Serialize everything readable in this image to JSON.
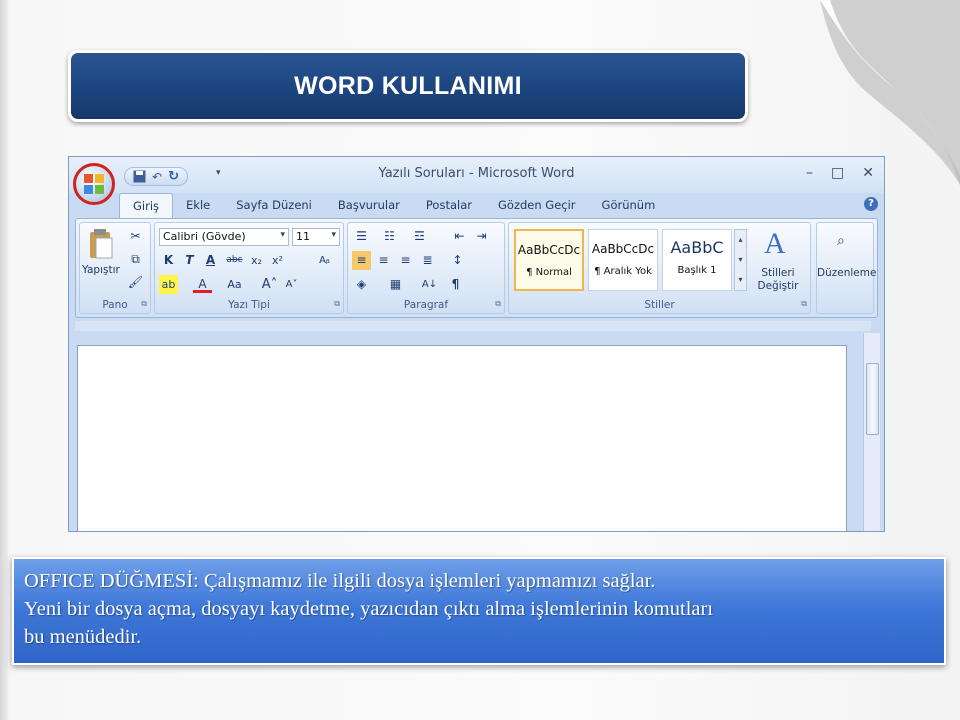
{
  "slide": {
    "title": "WORD KULLANIMI",
    "caption": [
      "OFFICE DÜĞMESİ: Çalışmamız ile ilgili dosya işlemleri yapmamızı sağlar.",
      "Yeni bir dosya açma, dosyayı kaydetme, yazıcıdan çıktı alma işlemlerinin komutları",
      "bu menüdedir."
    ]
  },
  "window": {
    "title": "Yazılı Soruları - Microsoft Word",
    "controls": [
      "–",
      "□",
      "✕"
    ]
  },
  "tabs": [
    "Giriş",
    "Ekle",
    "Sayfa Düzeni",
    "Başvurular",
    "Postalar",
    "Gözden Geçir",
    "Görünüm"
  ],
  "ribbon": {
    "pano": {
      "label": "Pano",
      "paste": "Yapıştır"
    },
    "font": {
      "label": "Yazı Tipi",
      "family": "Calibri (Gövde)",
      "size": "11"
    },
    "paragraph": {
      "label": "Paragraf"
    },
    "styles": {
      "label": "Stiller",
      "items": [
        {
          "preview": "AaBbCcDc",
          "name": "¶ Normal"
        },
        {
          "preview": "AaBbCcDc",
          "name": "¶ Aralık Yok"
        },
        {
          "preview": "AaBbC",
          "name": "Başlık 1"
        }
      ],
      "change": "Stilleri Değiştir"
    },
    "editing": {
      "label": "Düzenleme"
    }
  },
  "colors": {
    "banner": "#1c4580",
    "caption": "#3f78d8",
    "office_ring": "#d0221f"
  }
}
